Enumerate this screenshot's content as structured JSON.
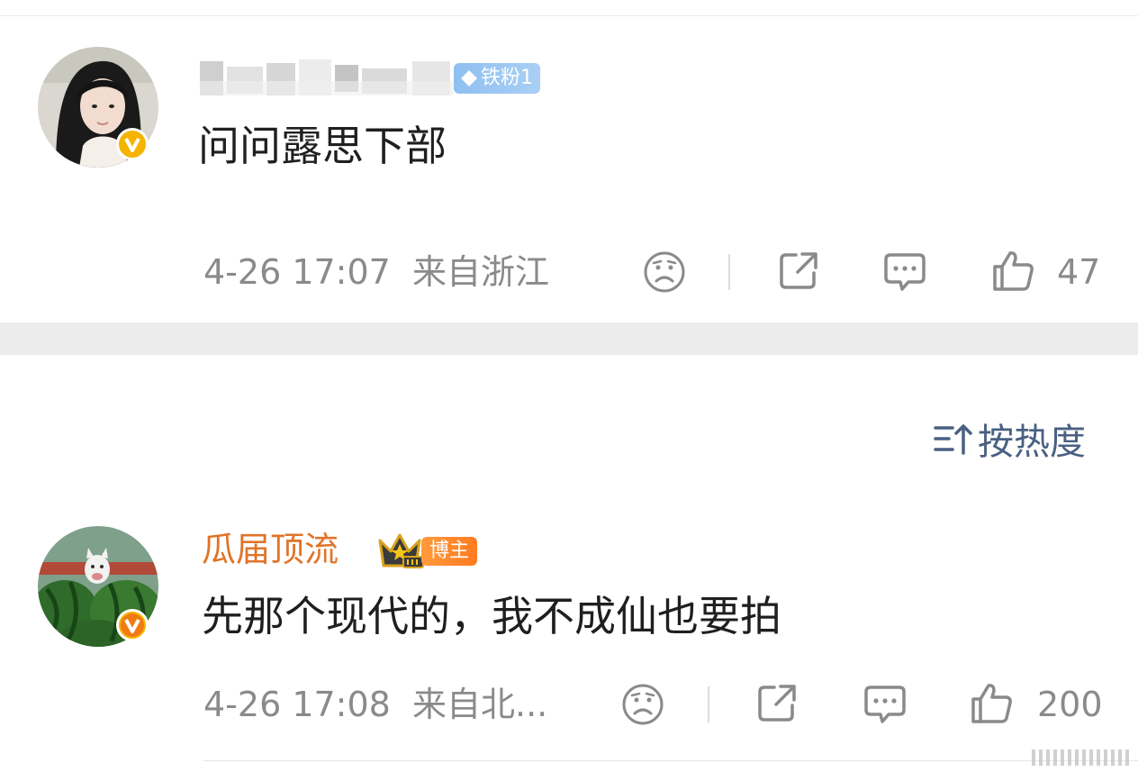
{
  "comments": [
    {
      "username": "",
      "fan_badge": "铁粉1",
      "text": "问问露思下部",
      "time": "4-26 17:07",
      "location": "来自浙江",
      "likes": "47"
    },
    {
      "username": "瓜届顶流",
      "badge": "博主",
      "text": "先那个现代的，我不成仙也要拍",
      "time": "4-26 17:08",
      "location": "来自北...",
      "likes": "200"
    }
  ],
  "sort": {
    "label": "按热度"
  },
  "icons": {
    "dislike": "sad-face-icon",
    "share": "share-icon",
    "comment": "comment-bubble-icon",
    "like": "thumbs-up-icon",
    "sort": "sort-icon",
    "verified": "verified-v-icon"
  },
  "colors": {
    "username_orange": "#e0742a",
    "fan_badge_blue": "#8fc0f0",
    "verified_yellow": "#f5b400",
    "verified_orange": "#f07b12",
    "meta_gray": "#8a8a8a",
    "sort_blue": "#4a6082"
  }
}
